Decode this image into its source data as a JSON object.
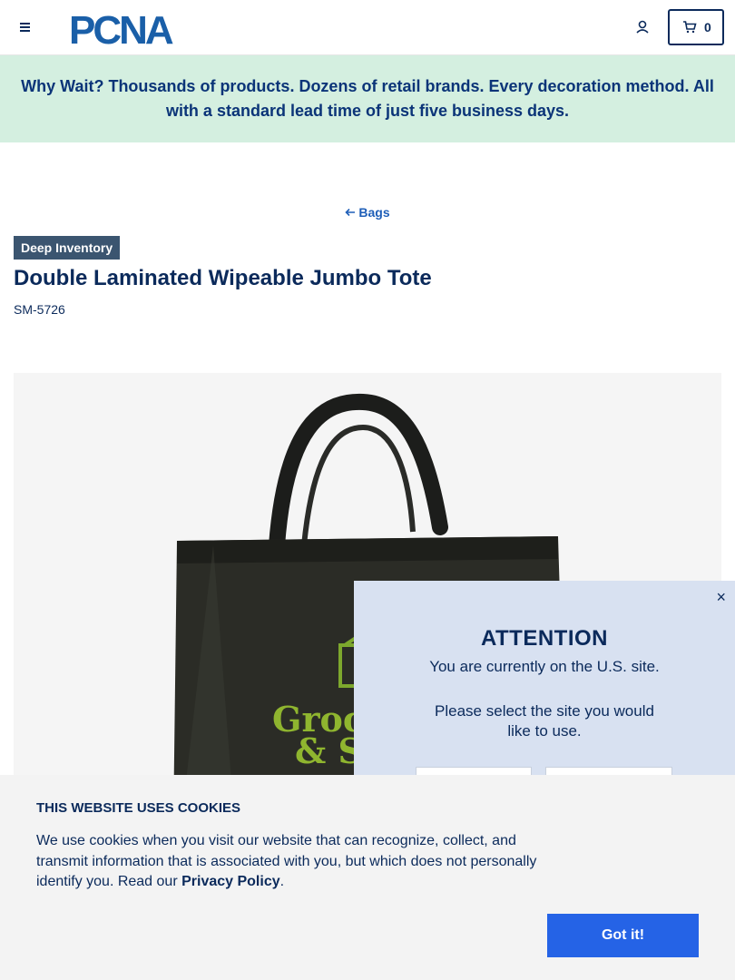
{
  "header": {
    "logo_text": "PCNA",
    "cart_count": "0"
  },
  "banner": {
    "text": "Why Wait? Thousands of products. Dozens of retail brands. Every decoration method. All with a standard lead time of just five business days."
  },
  "breadcrumb": {
    "back_label": "Bags"
  },
  "product": {
    "badge": "Deep Inventory",
    "title": "Double Laminated Wipeable Jumbo Tote",
    "sku": "SM-5726"
  },
  "attention": {
    "close": "×",
    "title": "ATTENTION",
    "message": "You are currently on the U.S. site.",
    "prompt": "Please select the site you would like to use."
  },
  "cookies": {
    "title": "THIS WEBSITE USES COOKIES",
    "text_before": "We use cookies when you visit our website that can recognize, collect, and transmit information that is associated with you, but which does not personally identify you. Read our ",
    "link": "Privacy Policy",
    "text_after": ".",
    "button": "Got it!"
  },
  "colors": {
    "brand_navy": "#0b2a5b",
    "banner_bg": "#d4efe0",
    "button_blue": "#2563e6",
    "badge_bg": "#3b5570",
    "modal_bg": "#d8e1f1"
  }
}
